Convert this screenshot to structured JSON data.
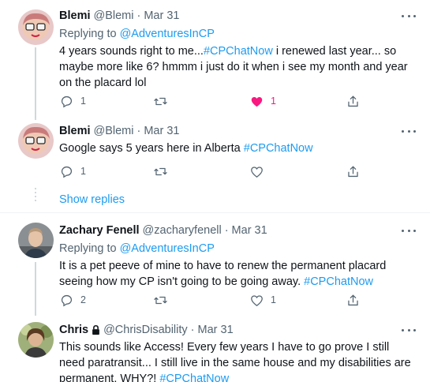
{
  "tweets": [
    {
      "name": "Blemi",
      "handle": "@Blemi",
      "date": "Mar 31",
      "replying_prefix": "Replying to ",
      "replying_to": "@AdventuresInCP",
      "text_parts": [
        {
          "t": "4 years sounds right to me...",
          "link": false
        },
        {
          "t": "#CPChatNow",
          "link": true
        },
        {
          "t": " i renewed last year... so maybe more like 6? hmmm i just do it when i see my month and year on the placard lol",
          "link": false
        }
      ],
      "reply_count": "1",
      "like_count": "1",
      "liked": true
    },
    {
      "name": "Blemi",
      "handle": "@Blemi",
      "date": "Mar 31",
      "text_parts": [
        {
          "t": "Google says 5 years here in Alberta ",
          "link": false
        },
        {
          "t": "#CPChatNow",
          "link": true
        }
      ],
      "reply_count": "1",
      "like_count": ""
    },
    {
      "name": "Zachary Fenell",
      "handle": "@zacharyfenell",
      "date": "Mar 31",
      "replying_prefix": "Replying to ",
      "replying_to": "@AdventuresInCP",
      "text_parts": [
        {
          "t": "It is a pet peeve of mine to have to renew the permanent placard seeing how my CP isn't going to be going away. ",
          "link": false
        },
        {
          "t": "#CPChatNow",
          "link": true
        }
      ],
      "reply_count": "2",
      "like_count": "1"
    },
    {
      "name": "Chris",
      "handle": "@ChrisDisability",
      "date": "Mar 31",
      "text_parts": [
        {
          "t": "This sounds like Access! Every few years I have to go prove I still need paratransit... I still live in the same house and my disabilities are permanent. WHY?! ",
          "link": false
        },
        {
          "t": "#CPChatNow",
          "link": true
        }
      ]
    }
  ],
  "show_replies": "Show replies",
  "dot": "·",
  "colors": {
    "link": "#1d9bf0",
    "like": "#f91880",
    "muted": "#536471"
  },
  "icons": [
    "more-icon",
    "reply-icon",
    "retweet-icon",
    "like-icon",
    "share-icon",
    "lock-icon"
  ]
}
